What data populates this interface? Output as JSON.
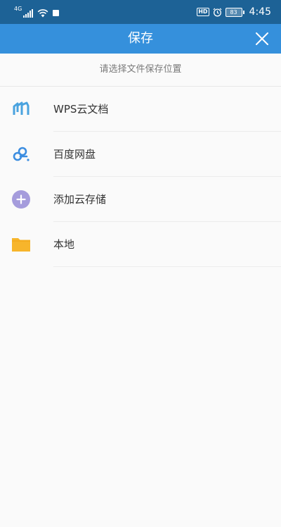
{
  "status_bar": {
    "network_type": "4G",
    "battery_level": "83",
    "time": "4:45",
    "hd_label": "HD"
  },
  "header": {
    "title": "保存"
  },
  "hint": "请选择文件保存位置",
  "locations": [
    {
      "label": "WPS云文档",
      "icon": "wps-cloud-icon"
    },
    {
      "label": "百度网盘",
      "icon": "baidu-netdisk-icon"
    },
    {
      "label": "添加云存储",
      "icon": "add-cloud-icon"
    },
    {
      "label": "本地",
      "icon": "folder-icon"
    }
  ],
  "colors": {
    "status_bar": "#1d6296",
    "title_bar": "#3590dc",
    "wps_icon": "#4aa3df",
    "baidu_icon": "#3b8de0",
    "add_icon": "#a59cdc",
    "folder_icon": "#f7b52b"
  }
}
